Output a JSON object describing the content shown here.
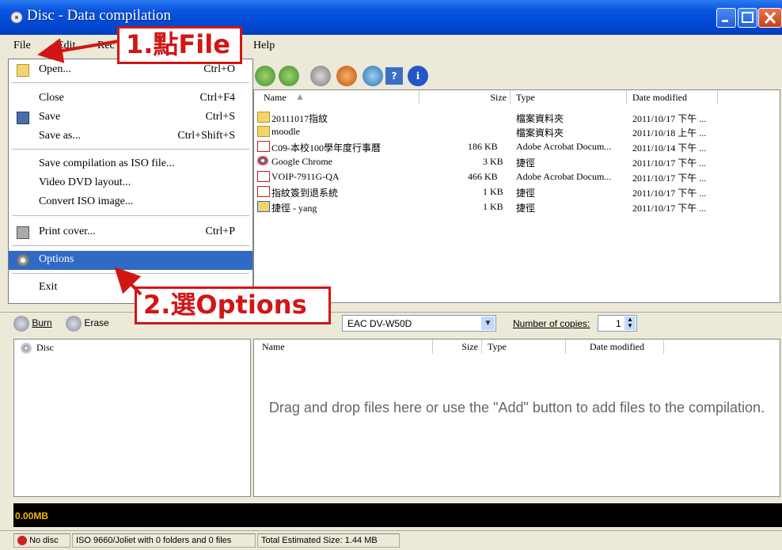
{
  "window": {
    "title": "Disc - Data compilation"
  },
  "menu": {
    "file": "File",
    "edit": "Edit",
    "recorder": "Rec",
    "help": "Help"
  },
  "file_menu": {
    "open": "Open...",
    "open_shortcut": "Ctrl+O",
    "close": "Close",
    "close_shortcut": "Ctrl+F4",
    "save": "Save",
    "save_shortcut": "Ctrl+S",
    "save_as": "Save as...",
    "save_as_shortcut": "Ctrl+Shift+S",
    "save_iso": "Save compilation as ISO file...",
    "video_dvd": "Video DVD layout...",
    "convert_iso": "Convert ISO image...",
    "print_cover": "Print cover...",
    "print_cover_shortcut": "Ctrl+P",
    "options": "Options",
    "exit": "Exit"
  },
  "browser": {
    "headers": {
      "name": "Name",
      "size": "Size",
      "type": "Type",
      "date": "Date modified"
    },
    "rows": [
      {
        "name": "20111017指紋",
        "size": "",
        "type": "檔案資料夾",
        "date": "2011/10/17 下午 ..."
      },
      {
        "name": "moodle",
        "size": "",
        "type": "檔案資料夾",
        "date": "2011/10/18 上午 ..."
      },
      {
        "name": "C09-本校100學年度行事曆",
        "size": "186 KB",
        "type": "Adobe Acrobat Docum...",
        "date": "2011/10/14 下午 ..."
      },
      {
        "name": "Google Chrome",
        "size": "3 KB",
        "type": "捷徑",
        "date": "2011/10/17 下午 ..."
      },
      {
        "name": "VOIP-7911G-QA",
        "size": "466 KB",
        "type": "Adobe Acrobat Docum...",
        "date": "2011/10/17 下午 ..."
      },
      {
        "name": "指紋簽到退系統",
        "size": "1 KB",
        "type": "捷徑",
        "date": "2011/10/17 下午 ..."
      },
      {
        "name": "捷徑 - yang",
        "size": "1 KB",
        "type": "捷徑",
        "date": "2011/10/17 下午 ..."
      }
    ]
  },
  "lower_toolbar": {
    "burn": "Burn",
    "erase": "Erase",
    "drive": "EAC DV-W50D",
    "copies_label": "Number of copies:",
    "copies_value": "1"
  },
  "tree": {
    "root": "Disc"
  },
  "compilation": {
    "headers": {
      "name": "Name",
      "size": "Size",
      "type": "Type",
      "date": "Date modified"
    },
    "empty_hint": "Drag and drop files here or use the \"Add\" button to add files to the compilation."
  },
  "capacity": {
    "label": "0.00MB"
  },
  "status": {
    "disc": "No disc",
    "fs": "ISO 9660/Joliet with 0 folders and 0 files",
    "total": "Total Estimated Size: 1.44 MB"
  },
  "annotations": {
    "step1": "1.點File",
    "step2": "2.選Options"
  },
  "colors": {
    "titlebar": "#0148d2",
    "highlight": "#316AC5",
    "annotation": "#d21515"
  }
}
